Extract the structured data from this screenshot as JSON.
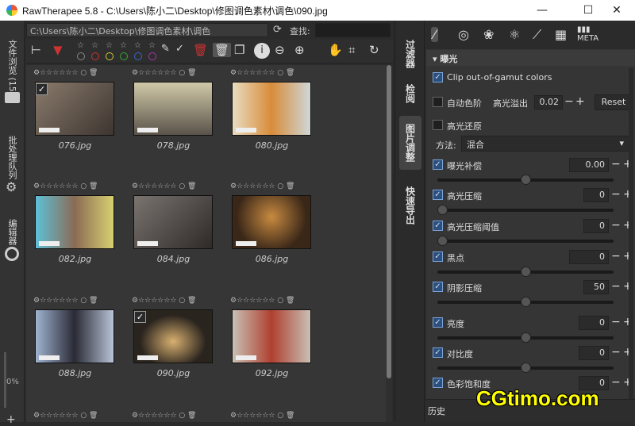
{
  "window": {
    "title": "RawTherapee 5.8 - C:\\Users\\陈小二\\Desktop\\修图调色素材\\调色\\090.jpg",
    "minimize": "—",
    "maximize": "☐",
    "close": "✕"
  },
  "left_tabs": {
    "file_browser": "文件浏览 (15)",
    "batch_queue": "批处理队列",
    "editor": "编辑器",
    "progress": "0%"
  },
  "browser": {
    "path": "C:\\Users\\陈小二\\Desktop\\修图调色素材\\调色",
    "find_label": "查找:",
    "find_value": "",
    "thumbnails": [
      {
        "name": "076.jpg",
        "checked": true
      },
      {
        "name": "078.jpg",
        "checked": false
      },
      {
        "name": "080.jpg",
        "checked": false
      },
      {
        "name": "082.jpg",
        "checked": false
      },
      {
        "name": "084.jpg",
        "checked": false
      },
      {
        "name": "086.jpg",
        "checked": false
      },
      {
        "name": "088.jpg",
        "checked": false
      },
      {
        "name": "090.jpg",
        "checked": true
      },
      {
        "name": "092.jpg",
        "checked": false
      }
    ],
    "thumb_colors": [
      "#6b6258",
      "#9a937a",
      "#d9c9a6",
      "#7fa6b8",
      "#4a4440",
      "#5a3e2a",
      "#8aa0c0",
      "#3a3028",
      "#c9c2b8"
    ],
    "accent_colors": [
      "#cc3333",
      "#cccc33",
      "#33aa33",
      "#3366cc",
      "#aa33aa"
    ]
  },
  "mid_tabs": {
    "filter": "过滤器",
    "inspect": "检阅",
    "image_adjust": "图片调整",
    "quick_export": "快速导出"
  },
  "exposure_panel": {
    "section_title": "曝光",
    "clip_oog": "Clip out-of-gamut colors",
    "auto_levels": "自动色阶",
    "highlight_clip_label": "高光溢出",
    "highlight_clip_value": "0.02",
    "reset": "Reset",
    "highlight_recon": "高光还原",
    "method_label": "方法:",
    "method_value": "混合",
    "exposure_comp": {
      "label": "曝光补偿",
      "value": "0.00"
    },
    "hl_compression": {
      "label": "高光压缩",
      "value": "0"
    },
    "hl_comp_threshold": {
      "label": "高光压缩阈值",
      "value": "0"
    },
    "black": {
      "label": "黑点",
      "value": "0"
    },
    "shadow_comp": {
      "label": "阴影压缩",
      "value": "50"
    },
    "brightness": {
      "label": "亮度",
      "value": "0"
    },
    "contrast": {
      "label": "对比度",
      "value": "0"
    },
    "saturation": {
      "label": "色彩饱和度",
      "value": "0"
    },
    "sliders": {
      "exposure": 0.5,
      "hl_compression": 0.0,
      "hl_threshold": 0.0,
      "black": 0.5,
      "shadow": 0.5,
      "brightness": 0.5,
      "contrast": 0.5
    }
  },
  "history": {
    "label": "历史"
  },
  "watermark": "CGtimo.com"
}
